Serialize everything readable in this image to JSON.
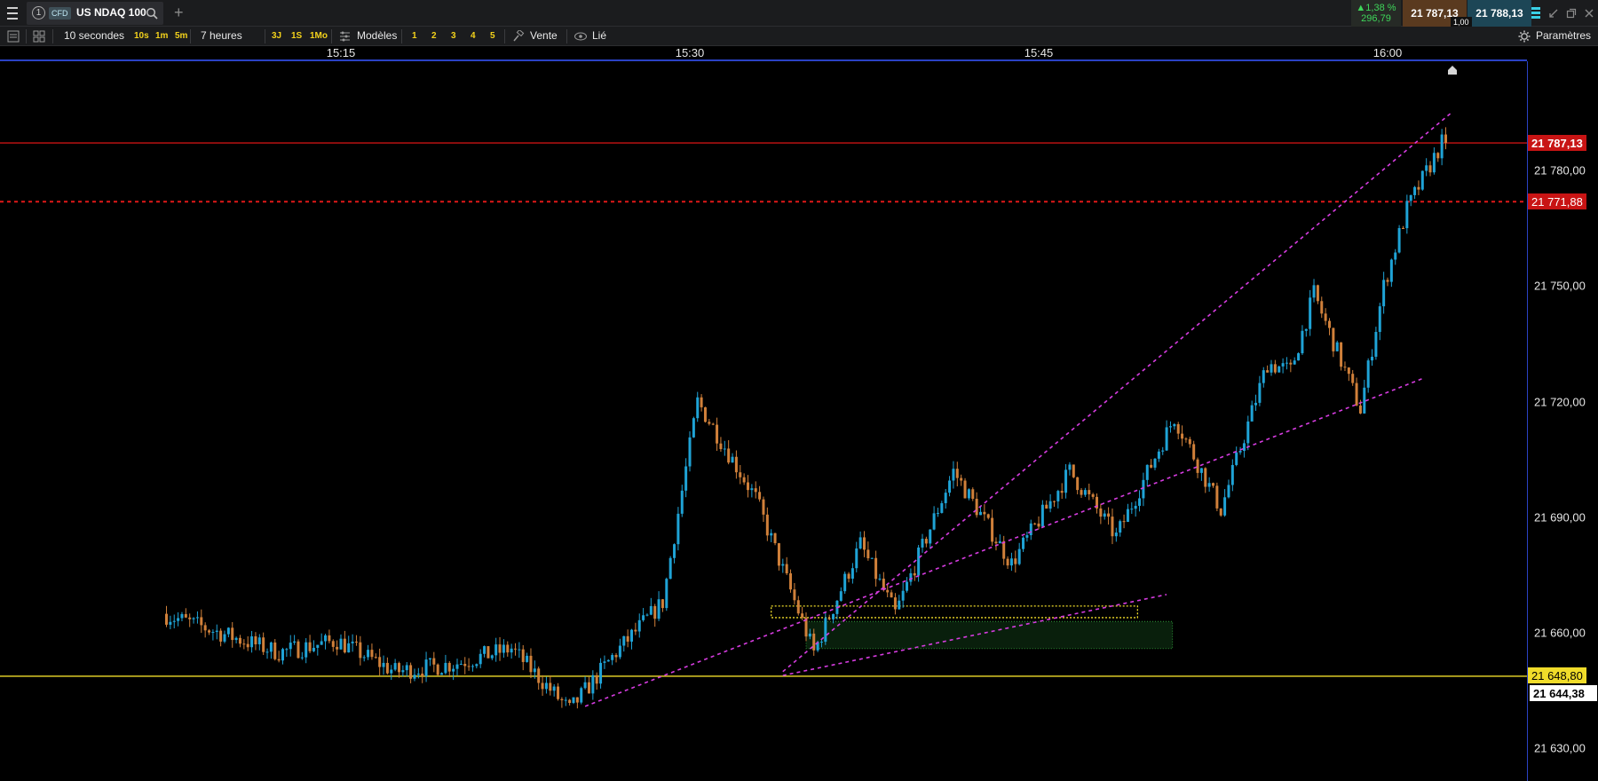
{
  "topbar": {
    "tab_number": "1",
    "cfd_badge": "CFD",
    "instrument": "US NDAQ 100",
    "add_tab": "+",
    "change_pct": "▲1,38 %",
    "change_pts": "296,79",
    "sell_price": "21 787,13",
    "buy_price": "21 788,13",
    "spread": "1,00"
  },
  "toolbar": {
    "interval": "10 secondes",
    "quick_intervals": [
      "10s",
      "1m",
      "5m"
    ],
    "range": "7 heures",
    "quick_ranges": [
      "3J",
      "1S",
      "1Mo"
    ],
    "templates": "Modèles",
    "presets": [
      "1",
      "2",
      "3",
      "4",
      "5"
    ],
    "side": "Vente",
    "linked": "Lié",
    "settings": "Paramètres"
  },
  "time_axis": {
    "labels": [
      "15:15",
      "15:30",
      "15:45",
      "16:00"
    ]
  },
  "price_axis": {
    "labels": [
      "21 780,00",
      "21 750,00",
      "21 720,00",
      "21 690,00",
      "21 660,00",
      "21 630,00"
    ],
    "current_price": "21 787,13",
    "red_level": "21 771,88",
    "yellow_level": "21 648,80",
    "low_marker": "21 644,38"
  },
  "colors": {
    "bull": "#1fa3d6",
    "bear": "#d0803a",
    "current_line": "#c81414",
    "red_level_line": "#e01818",
    "yellow_line": "#f0dc2a",
    "trendline": "#d63ce0",
    "axis_border": "#2a42c4"
  },
  "chart_data": {
    "type": "candlestick",
    "instrument": "US NDAQ 100",
    "timeframe": "10 secondes",
    "x_ticks": [
      "15:15",
      "15:30",
      "15:45",
      "16:00"
    ],
    "ylim": [
      21626,
      21800
    ],
    "anchors": [
      {
        "t": "15:07:30",
        "price": 21665
      },
      {
        "t": "15:12:30",
        "price": 21655
      },
      {
        "t": "15:15:00",
        "price": 21658
      },
      {
        "t": "15:17:30",
        "price": 21650
      },
      {
        "t": "15:20:00",
        "price": 21652
      },
      {
        "t": "15:22:30",
        "price": 21656
      },
      {
        "t": "15:25:00",
        "price": 21640
      },
      {
        "t": "15:27:00",
        "price": 21655
      },
      {
        "t": "15:29:00",
        "price": 21668
      },
      {
        "t": "15:30:30",
        "price": 21720
      },
      {
        "t": "15:33:00",
        "price": 21695
      },
      {
        "t": "15:35:30",
        "price": 21655
      },
      {
        "t": "15:37:30",
        "price": 21683
      },
      {
        "t": "15:39:00",
        "price": 21665
      },
      {
        "t": "15:41:30",
        "price": 21702
      },
      {
        "t": "15:44:00",
        "price": 21678
      },
      {
        "t": "15:46:30",
        "price": 21702
      },
      {
        "t": "15:48:30",
        "price": 21685
      },
      {
        "t": "15:51:00",
        "price": 21716
      },
      {
        "t": "15:53:00",
        "price": 21692
      },
      {
        "t": "15:55:00",
        "price": 21730
      },
      {
        "t": "15:56:00",
        "price": 21728
      },
      {
        "t": "15:57:00",
        "price": 21748
      },
      {
        "t": "15:59:00",
        "price": 21718
      },
      {
        "t": "16:00:00",
        "price": 21750
      },
      {
        "t": "16:01:00",
        "price": 21770
      },
      {
        "t": "16:02:30",
        "price": 21787.13
      }
    ],
    "horizontal_levels": [
      {
        "label": "21 787,13",
        "price": 21787.13,
        "style": "solid",
        "color": "#c81414"
      },
      {
        "label": "21 771,88",
        "price": 21771.88,
        "style": "dashed",
        "color": "#e01818"
      },
      {
        "label": "21 648,80",
        "price": 21648.8,
        "style": "solid",
        "color": "#f0dc2a"
      }
    ],
    "trendlines": [
      {
        "from": {
          "t": "15:25:30",
          "price": 21641
        },
        "to": {
          "t": "16:01:30",
          "price": 21726
        }
      },
      {
        "from": {
          "t": "15:34:00",
          "price": 21649
        },
        "to": {
          "t": "15:50:30",
          "price": 21670
        }
      },
      {
        "from": {
          "t": "15:34:00",
          "price": 21650
        },
        "to": {
          "t": "16:02:45",
          "price": 21795
        }
      }
    ],
    "zones": [
      {
        "type": "yellow-dotted",
        "t_start": "15:33:30",
        "t_end": "15:49:15",
        "price_top": 21667,
        "price_bottom": 21664
      },
      {
        "type": "green",
        "t_start": "15:35:00",
        "t_end": "15:50:45",
        "price_top": 21663,
        "price_bottom": 21656
      }
    ]
  }
}
